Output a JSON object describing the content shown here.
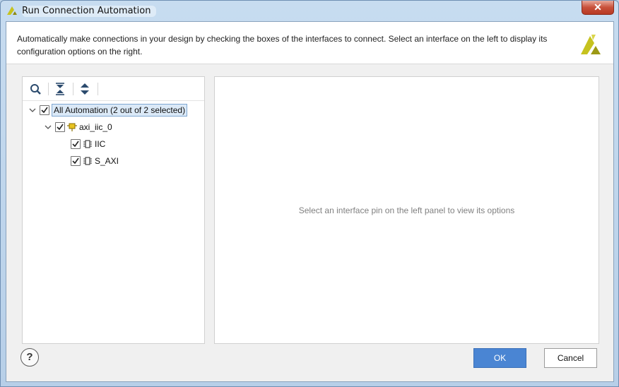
{
  "window": {
    "title": "Run Connection Automation",
    "close_glyph": "✕"
  },
  "header": {
    "description": "Automatically make connections in your design by checking the boxes of the interfaces to connect. Select an interface on the left to display its configuration options on the right."
  },
  "toolbar": {
    "icons": [
      "search-icon",
      "collapse-all-icon",
      "expand-all-icon"
    ]
  },
  "tree": {
    "root": {
      "label": "All Automation (2 out of 2 selected)",
      "checked": true,
      "expanded": true
    },
    "child": {
      "label": "axi_iic_0",
      "checked": true,
      "expanded": true,
      "icon": "ip-block-icon"
    },
    "leaves": [
      {
        "label": "IIC",
        "checked": true,
        "icon": "interface-icon"
      },
      {
        "label": "S_AXI",
        "checked": true,
        "icon": "interface-icon"
      }
    ]
  },
  "right_panel": {
    "hint": "Select an interface pin on the left panel to view its options"
  },
  "buttons": {
    "help": "?",
    "ok": "OK",
    "cancel": "Cancel"
  },
  "colors": {
    "accent": "#4a85d3",
    "brand_logo": "#c6c21f"
  }
}
